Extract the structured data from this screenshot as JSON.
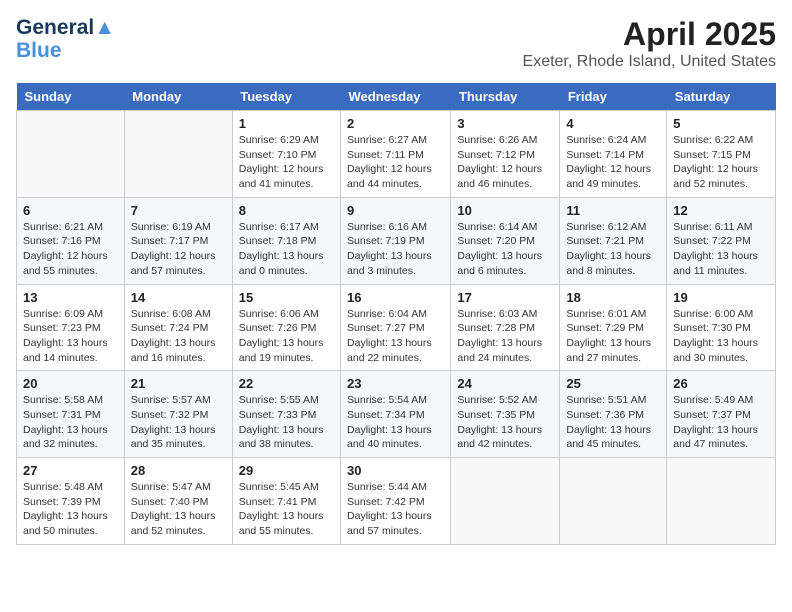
{
  "logo": {
    "line1": "General",
    "line2": "Blue"
  },
  "title": "April 2025",
  "subtitle": "Exeter, Rhode Island, United States",
  "days_of_week": [
    "Sunday",
    "Monday",
    "Tuesday",
    "Wednesday",
    "Thursday",
    "Friday",
    "Saturday"
  ],
  "weeks": [
    [
      {
        "day": "",
        "sunrise": "",
        "sunset": "",
        "daylight": ""
      },
      {
        "day": "",
        "sunrise": "",
        "sunset": "",
        "daylight": ""
      },
      {
        "day": "1",
        "sunrise": "Sunrise: 6:29 AM",
        "sunset": "Sunset: 7:10 PM",
        "daylight": "Daylight: 12 hours and 41 minutes."
      },
      {
        "day": "2",
        "sunrise": "Sunrise: 6:27 AM",
        "sunset": "Sunset: 7:11 PM",
        "daylight": "Daylight: 12 hours and 44 minutes."
      },
      {
        "day": "3",
        "sunrise": "Sunrise: 6:26 AM",
        "sunset": "Sunset: 7:12 PM",
        "daylight": "Daylight: 12 hours and 46 minutes."
      },
      {
        "day": "4",
        "sunrise": "Sunrise: 6:24 AM",
        "sunset": "Sunset: 7:14 PM",
        "daylight": "Daylight: 12 hours and 49 minutes."
      },
      {
        "day": "5",
        "sunrise": "Sunrise: 6:22 AM",
        "sunset": "Sunset: 7:15 PM",
        "daylight": "Daylight: 12 hours and 52 minutes."
      }
    ],
    [
      {
        "day": "6",
        "sunrise": "Sunrise: 6:21 AM",
        "sunset": "Sunset: 7:16 PM",
        "daylight": "Daylight: 12 hours and 55 minutes."
      },
      {
        "day": "7",
        "sunrise": "Sunrise: 6:19 AM",
        "sunset": "Sunset: 7:17 PM",
        "daylight": "Daylight: 12 hours and 57 minutes."
      },
      {
        "day": "8",
        "sunrise": "Sunrise: 6:17 AM",
        "sunset": "Sunset: 7:18 PM",
        "daylight": "Daylight: 13 hours and 0 minutes."
      },
      {
        "day": "9",
        "sunrise": "Sunrise: 6:16 AM",
        "sunset": "Sunset: 7:19 PM",
        "daylight": "Daylight: 13 hours and 3 minutes."
      },
      {
        "day": "10",
        "sunrise": "Sunrise: 6:14 AM",
        "sunset": "Sunset: 7:20 PM",
        "daylight": "Daylight: 13 hours and 6 minutes."
      },
      {
        "day": "11",
        "sunrise": "Sunrise: 6:12 AM",
        "sunset": "Sunset: 7:21 PM",
        "daylight": "Daylight: 13 hours and 8 minutes."
      },
      {
        "day": "12",
        "sunrise": "Sunrise: 6:11 AM",
        "sunset": "Sunset: 7:22 PM",
        "daylight": "Daylight: 13 hours and 11 minutes."
      }
    ],
    [
      {
        "day": "13",
        "sunrise": "Sunrise: 6:09 AM",
        "sunset": "Sunset: 7:23 PM",
        "daylight": "Daylight: 13 hours and 14 minutes."
      },
      {
        "day": "14",
        "sunrise": "Sunrise: 6:08 AM",
        "sunset": "Sunset: 7:24 PM",
        "daylight": "Daylight: 13 hours and 16 minutes."
      },
      {
        "day": "15",
        "sunrise": "Sunrise: 6:06 AM",
        "sunset": "Sunset: 7:26 PM",
        "daylight": "Daylight: 13 hours and 19 minutes."
      },
      {
        "day": "16",
        "sunrise": "Sunrise: 6:04 AM",
        "sunset": "Sunset: 7:27 PM",
        "daylight": "Daylight: 13 hours and 22 minutes."
      },
      {
        "day": "17",
        "sunrise": "Sunrise: 6:03 AM",
        "sunset": "Sunset: 7:28 PM",
        "daylight": "Daylight: 13 hours and 24 minutes."
      },
      {
        "day": "18",
        "sunrise": "Sunrise: 6:01 AM",
        "sunset": "Sunset: 7:29 PM",
        "daylight": "Daylight: 13 hours and 27 minutes."
      },
      {
        "day": "19",
        "sunrise": "Sunrise: 6:00 AM",
        "sunset": "Sunset: 7:30 PM",
        "daylight": "Daylight: 13 hours and 30 minutes."
      }
    ],
    [
      {
        "day": "20",
        "sunrise": "Sunrise: 5:58 AM",
        "sunset": "Sunset: 7:31 PM",
        "daylight": "Daylight: 13 hours and 32 minutes."
      },
      {
        "day": "21",
        "sunrise": "Sunrise: 5:57 AM",
        "sunset": "Sunset: 7:32 PM",
        "daylight": "Daylight: 13 hours and 35 minutes."
      },
      {
        "day": "22",
        "sunrise": "Sunrise: 5:55 AM",
        "sunset": "Sunset: 7:33 PM",
        "daylight": "Daylight: 13 hours and 38 minutes."
      },
      {
        "day": "23",
        "sunrise": "Sunrise: 5:54 AM",
        "sunset": "Sunset: 7:34 PM",
        "daylight": "Daylight: 13 hours and 40 minutes."
      },
      {
        "day": "24",
        "sunrise": "Sunrise: 5:52 AM",
        "sunset": "Sunset: 7:35 PM",
        "daylight": "Daylight: 13 hours and 42 minutes."
      },
      {
        "day": "25",
        "sunrise": "Sunrise: 5:51 AM",
        "sunset": "Sunset: 7:36 PM",
        "daylight": "Daylight: 13 hours and 45 minutes."
      },
      {
        "day": "26",
        "sunrise": "Sunrise: 5:49 AM",
        "sunset": "Sunset: 7:37 PM",
        "daylight": "Daylight: 13 hours and 47 minutes."
      }
    ],
    [
      {
        "day": "27",
        "sunrise": "Sunrise: 5:48 AM",
        "sunset": "Sunset: 7:39 PM",
        "daylight": "Daylight: 13 hours and 50 minutes."
      },
      {
        "day": "28",
        "sunrise": "Sunrise: 5:47 AM",
        "sunset": "Sunset: 7:40 PM",
        "daylight": "Daylight: 13 hours and 52 minutes."
      },
      {
        "day": "29",
        "sunrise": "Sunrise: 5:45 AM",
        "sunset": "Sunset: 7:41 PM",
        "daylight": "Daylight: 13 hours and 55 minutes."
      },
      {
        "day": "30",
        "sunrise": "Sunrise: 5:44 AM",
        "sunset": "Sunset: 7:42 PM",
        "daylight": "Daylight: 13 hours and 57 minutes."
      },
      {
        "day": "",
        "sunrise": "",
        "sunset": "",
        "daylight": ""
      },
      {
        "day": "",
        "sunrise": "",
        "sunset": "",
        "daylight": ""
      },
      {
        "day": "",
        "sunrise": "",
        "sunset": "",
        "daylight": ""
      }
    ]
  ]
}
